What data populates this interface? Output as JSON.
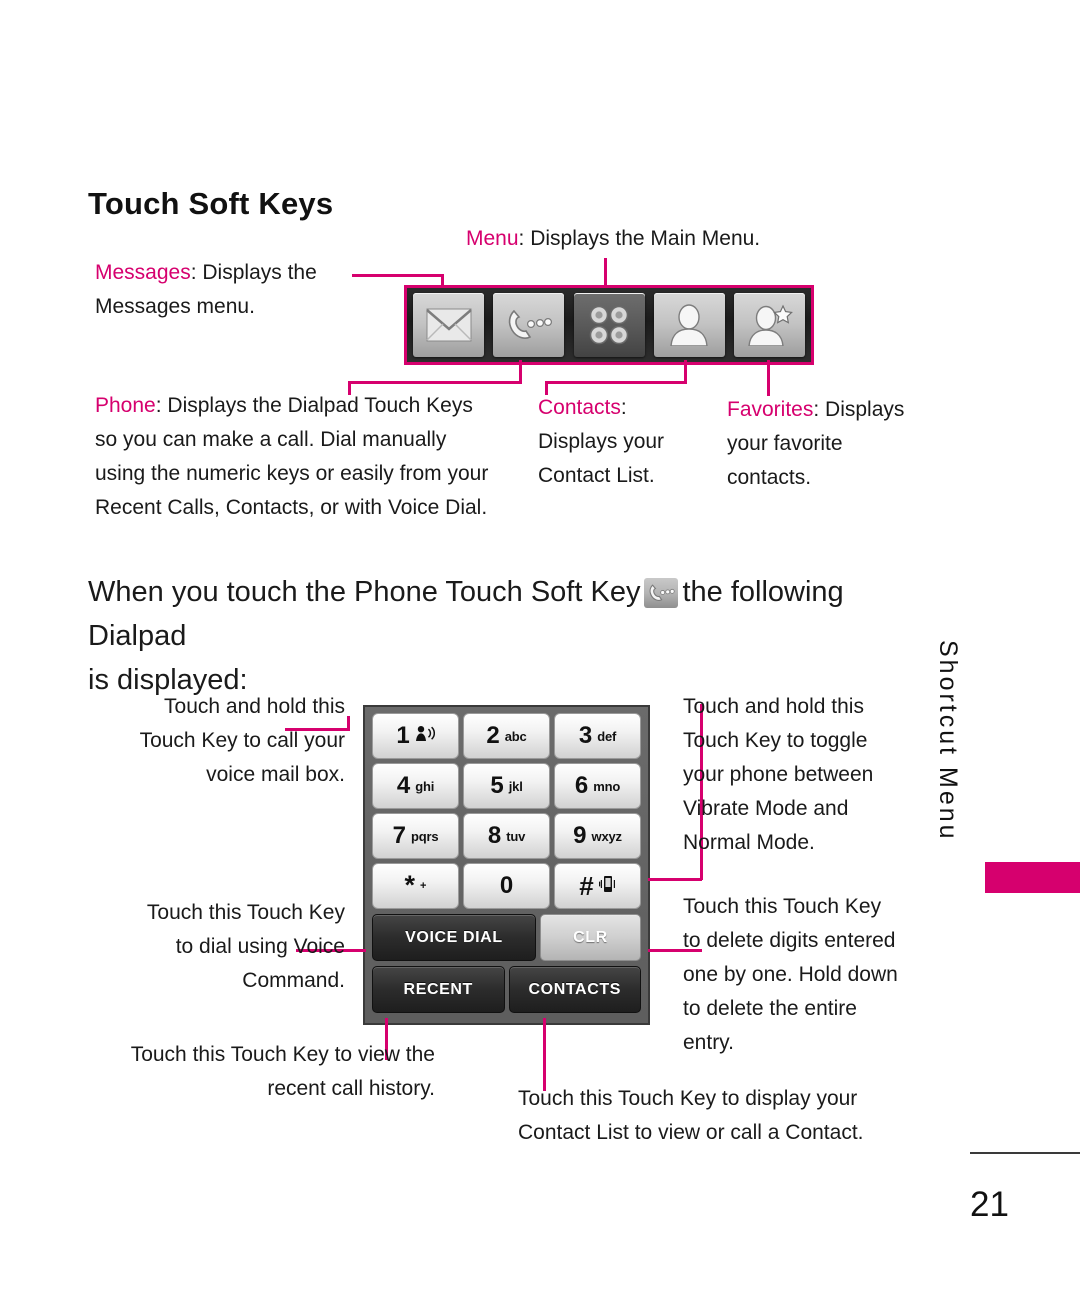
{
  "page": {
    "title": "Touch Soft Keys",
    "number": "21",
    "side_tab": "Shortcut Menu",
    "accent_color": "#D6006E"
  },
  "softkey_callouts": {
    "messages": {
      "label": "Messages",
      "text": ": Displays the",
      "line2": "Messages menu."
    },
    "menu": {
      "label": "Menu",
      "text": ": Displays the Main Menu."
    },
    "phone": {
      "label": "Phone",
      "text": ": Displays the Dialpad Touch Keys so you can make a call. Dial manually using the numeric keys or easily from your Recent Calls, Contacts, or with Voice Dial."
    },
    "contacts": {
      "label": "Contacts",
      "text": ":",
      "line2": "Displays your",
      "line3": "Contact List."
    },
    "favorites": {
      "label": "Favorites",
      "text": ": Displays",
      "line2": "your favorite",
      "line3": "contacts."
    }
  },
  "softkey_bar": {
    "keys": [
      {
        "name": "messages-softkey",
        "icon": "envelope-icon",
        "style": "light"
      },
      {
        "name": "phone-softkey",
        "icon": "phone-handset-icon",
        "style": "light"
      },
      {
        "name": "menu-softkey",
        "icon": "four-dot-grid-icon",
        "style": "dark"
      },
      {
        "name": "contacts-softkey",
        "icon": "person-icon",
        "style": "light"
      },
      {
        "name": "favorites-softkey",
        "icon": "person-star-icon",
        "style": "light"
      }
    ]
  },
  "intro": {
    "part1": "When you touch the Phone Touch Soft Key",
    "part2": "the following Dialpad",
    "line2": "is displayed:"
  },
  "dialpad": {
    "keys": [
      {
        "num": "1",
        "sub": "",
        "icon": "voicemail-icon"
      },
      {
        "num": "2",
        "sub": "abc",
        "icon": ""
      },
      {
        "num": "3",
        "sub": "def",
        "icon": ""
      },
      {
        "num": "4",
        "sub": "ghi",
        "icon": ""
      },
      {
        "num": "5",
        "sub": "jkl",
        "icon": ""
      },
      {
        "num": "6",
        "sub": "mno",
        "icon": ""
      },
      {
        "num": "7",
        "sub": "pqrs",
        "icon": ""
      },
      {
        "num": "8",
        "sub": "tuv",
        "icon": ""
      },
      {
        "num": "9",
        "sub": "wxyz",
        "icon": ""
      },
      {
        "num": "*",
        "sub": "+",
        "icon": ""
      },
      {
        "num": "0",
        "sub": "",
        "icon": ""
      },
      {
        "num": "#",
        "sub": "",
        "icon": "vibrate-icon"
      }
    ],
    "actions": {
      "voice_dial": "VOICE DIAL",
      "clr": "CLR",
      "recent": "RECENT",
      "contacts": "CONTACTS"
    }
  },
  "dialpad_callouts": {
    "voicemail": {
      "l1": "Touch and hold this",
      "l2": "Touch Key to call your",
      "l3": "voice mail box."
    },
    "vibrate": {
      "l1": "Touch and hold this",
      "l2": "Touch Key to toggle",
      "l3": "your phone between",
      "l4": "Vibrate Mode and",
      "l5": "Normal Mode."
    },
    "voice_dial": {
      "l1": "Touch this Touch Key",
      "l2": "to dial using Voice",
      "l3": "Command."
    },
    "clr": {
      "l1": "Touch this Touch Key",
      "l2": "to delete digits entered",
      "l3": "one by one. Hold down",
      "l4": "to delete the entire",
      "l5": "entry."
    },
    "recent": {
      "l1": "Touch this Touch Key to view the",
      "l2": "recent call history."
    },
    "contacts": {
      "l1": "Touch this Touch Key to display your",
      "l2": "Contact List to view or call a Contact."
    }
  }
}
